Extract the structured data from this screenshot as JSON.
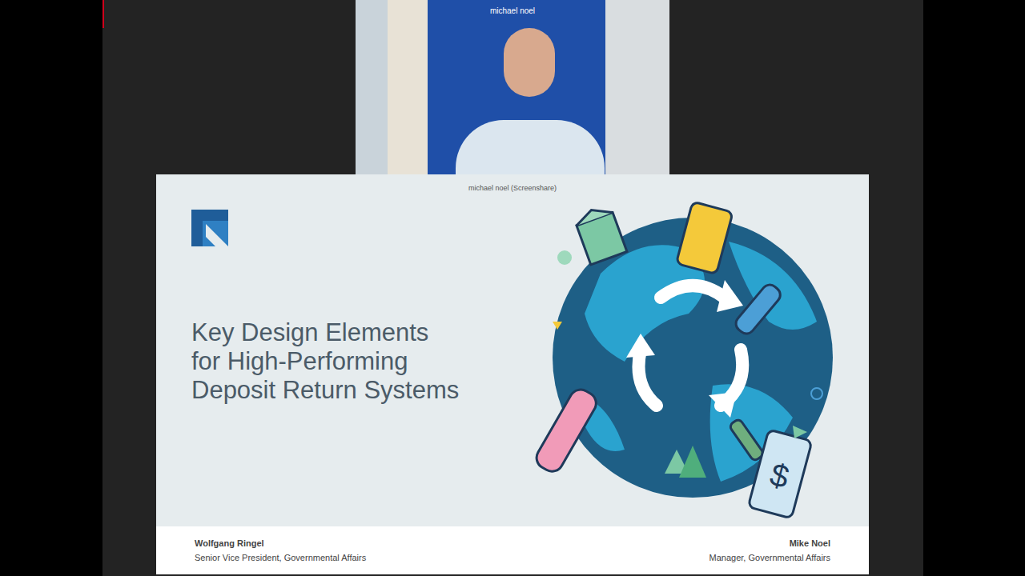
{
  "participants": [
    {
      "name": "michael noel"
    }
  ],
  "screenshare": {
    "label": "michael noel (Screenshare)",
    "slide": {
      "title": [
        "Key Design Elements",
        "for High-Performing",
        "Deposit Return Systems"
      ],
      "phone_symbol": "$",
      "presenters": [
        {
          "name": "Wolfgang Ringel",
          "role": "Senior Vice President, Governmental Affairs"
        },
        {
          "name": "Mike Noel",
          "role": "Manager, Governmental Affairs"
        }
      ]
    }
  }
}
